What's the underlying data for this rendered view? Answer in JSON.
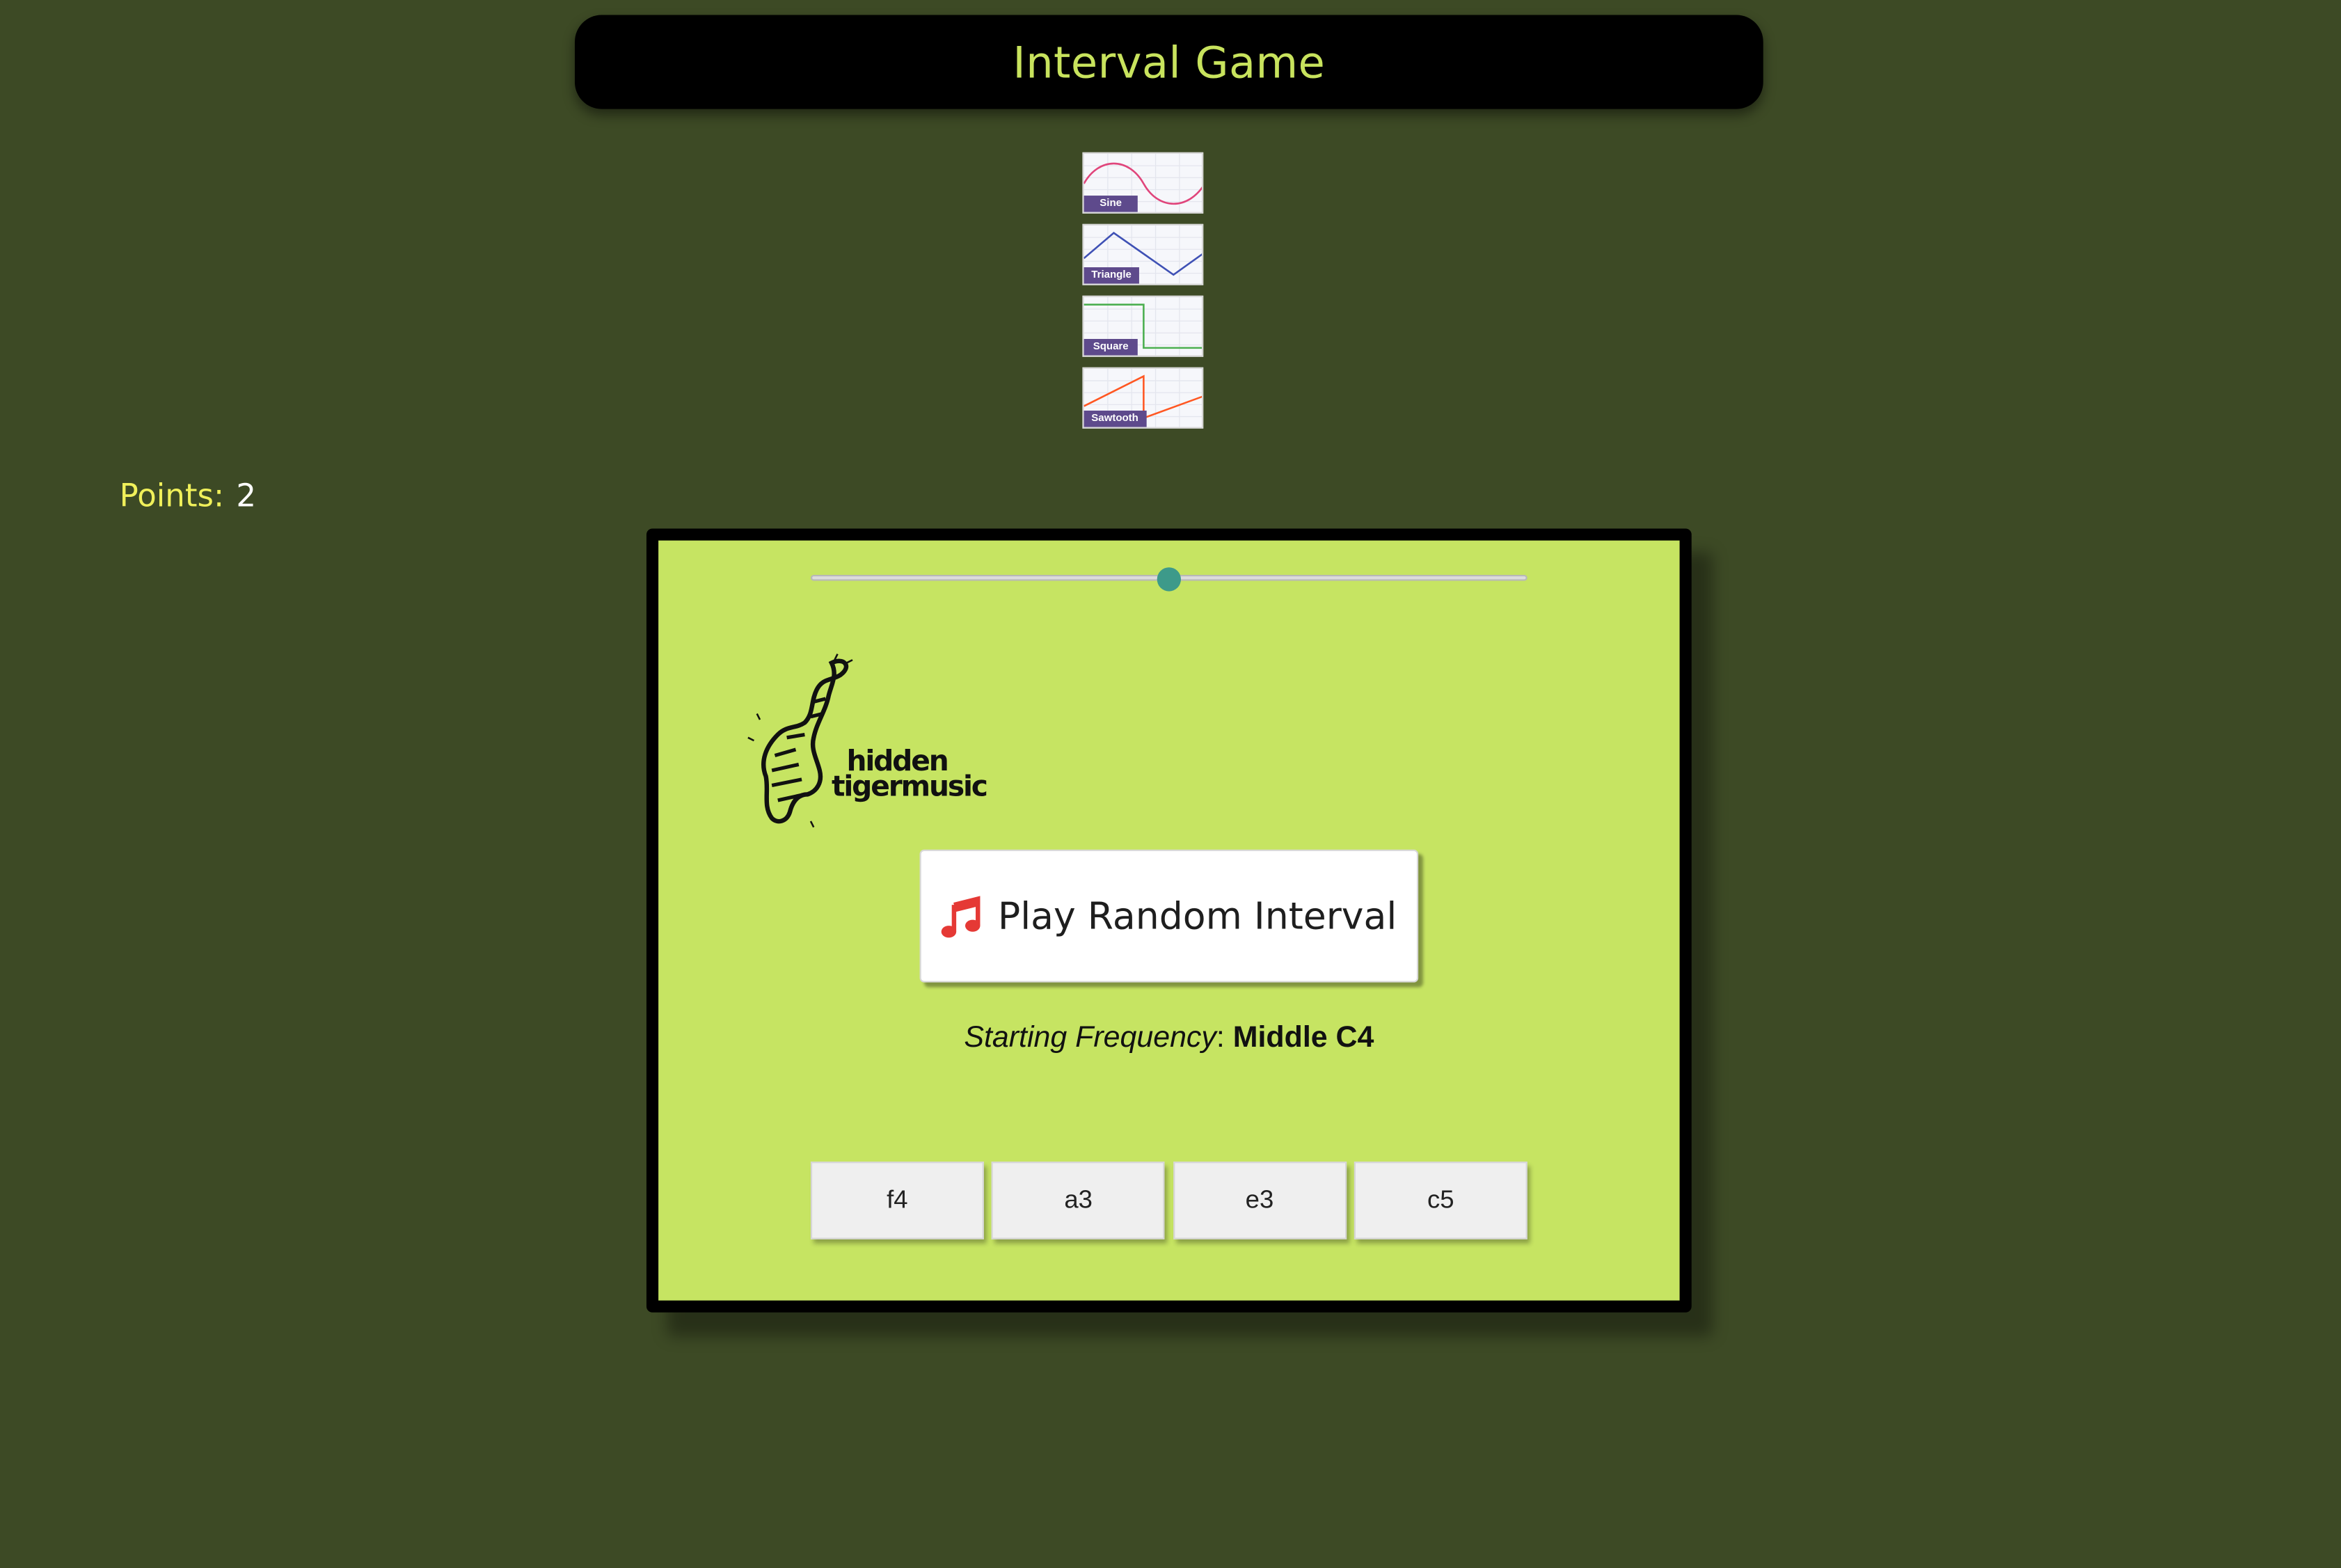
{
  "header": {
    "title": "Interval Game"
  },
  "waveforms": [
    {
      "label": "Sine",
      "icon": "sine-wave-icon",
      "color": "#e0457b"
    },
    {
      "label": "Triangle",
      "icon": "triangle-wave-icon",
      "color": "#3f51b5"
    },
    {
      "label": "Square",
      "icon": "square-wave-icon",
      "color": "#4caf50"
    },
    {
      "label": "Sawtooth",
      "icon": "sawtooth-wave-icon",
      "color": "#ff5722"
    }
  ],
  "score": {
    "label": "Points:",
    "value": "2"
  },
  "game": {
    "slider": {
      "fraction": 0.5
    },
    "logo": {
      "line1": "hidden",
      "line2": "tigermusic"
    },
    "play_button": {
      "label": "Play Random Interval",
      "icon": "music-note-icon",
      "icon_color": "#e53935"
    },
    "starting_frequency": {
      "label": "Starting Frequency",
      "separator": ":",
      "value": "Middle C4"
    },
    "answers": [
      "f4",
      "a3",
      "e3",
      "c5"
    ]
  },
  "colors": {
    "page_background": "#3d4a25",
    "card_background": "#c6e462",
    "accent": "#c8e35d",
    "slider_thumb": "#3d9a8a"
  }
}
